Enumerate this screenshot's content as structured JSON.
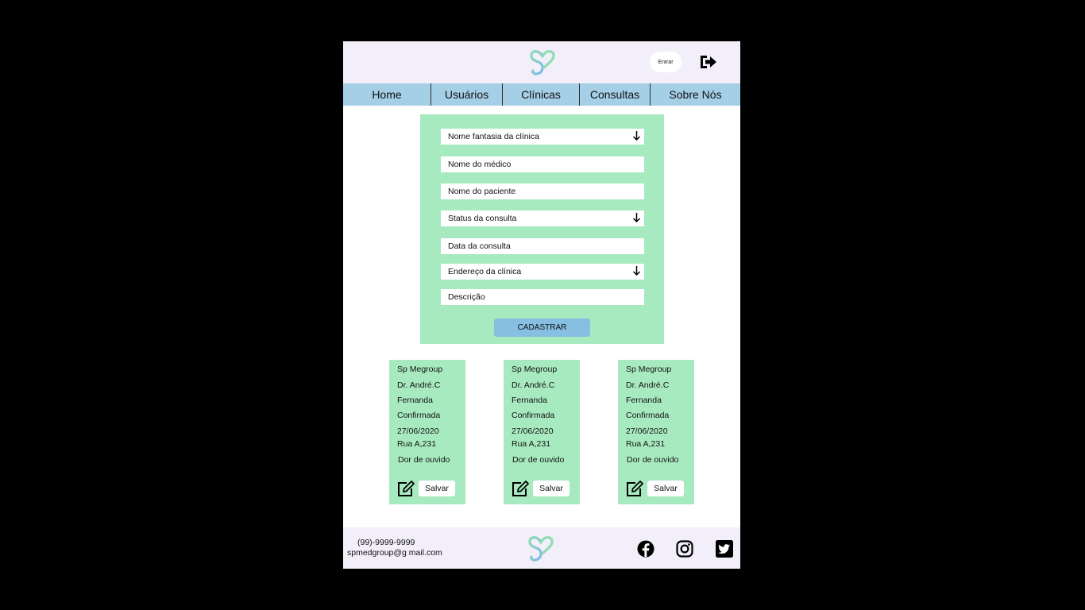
{
  "header": {
    "logo": "sp-heart-logo",
    "enter_label": "Entrar",
    "logout_icon": "logout-icon"
  },
  "nav": {
    "items": [
      {
        "label": "Home"
      },
      {
        "label": "Usuários"
      },
      {
        "label": "Clínicas"
      },
      {
        "label": "Consultas"
      },
      {
        "label": "Sobre Nós"
      }
    ]
  },
  "form": {
    "fields": [
      {
        "placeholder": "Nome fantasia da clínica",
        "type": "select"
      },
      {
        "placeholder": "Nome do médico",
        "type": "text"
      },
      {
        "placeholder": "Nome do paciente",
        "type": "text"
      },
      {
        "placeholder": "Status da consulta",
        "type": "select"
      },
      {
        "placeholder": "Data da consulta",
        "type": "text"
      },
      {
        "placeholder": "Endereço da clínica",
        "type": "select"
      },
      {
        "placeholder": "Descrição",
        "type": "text"
      }
    ],
    "submit_label": "CADASTRAR"
  },
  "cards": [
    {
      "clinic": "Sp Megroup",
      "doctor": "Dr. André.C",
      "patient": "Fernanda",
      "status": "Confirmada",
      "date": "27/06/2020",
      "address": "Rua A,231",
      "description": "Dor de ouvido",
      "save_label": "Salvar"
    },
    {
      "clinic": "Sp Megroup",
      "doctor": "Dr. André.C",
      "patient": "Fernanda",
      "status": "Confirmada",
      "date": "27/06/2020",
      "address": "Rua A,231",
      "description": "Dor de ouvido",
      "save_label": "Salvar"
    },
    {
      "clinic": "Sp Megroup",
      "doctor": "Dr. André.C",
      "patient": "Fernanda",
      "status": "Confirmada",
      "date": "27/06/2020",
      "address": "Rua A,231",
      "description": "Dor de ouvido",
      "save_label": "Salvar"
    }
  ],
  "footer": {
    "phone": "(99)-9999-9999",
    "email": "spmedgroup@g mail.com",
    "social": [
      "facebook-icon",
      "instagram-icon",
      "twitter-icon"
    ]
  },
  "colors": {
    "header_bg": "#f3effa",
    "nav_bg": "#a5cfe6",
    "form_bg": "#a8eac0",
    "button_bg": "#87bfe2",
    "outer_bg": "#000000"
  }
}
